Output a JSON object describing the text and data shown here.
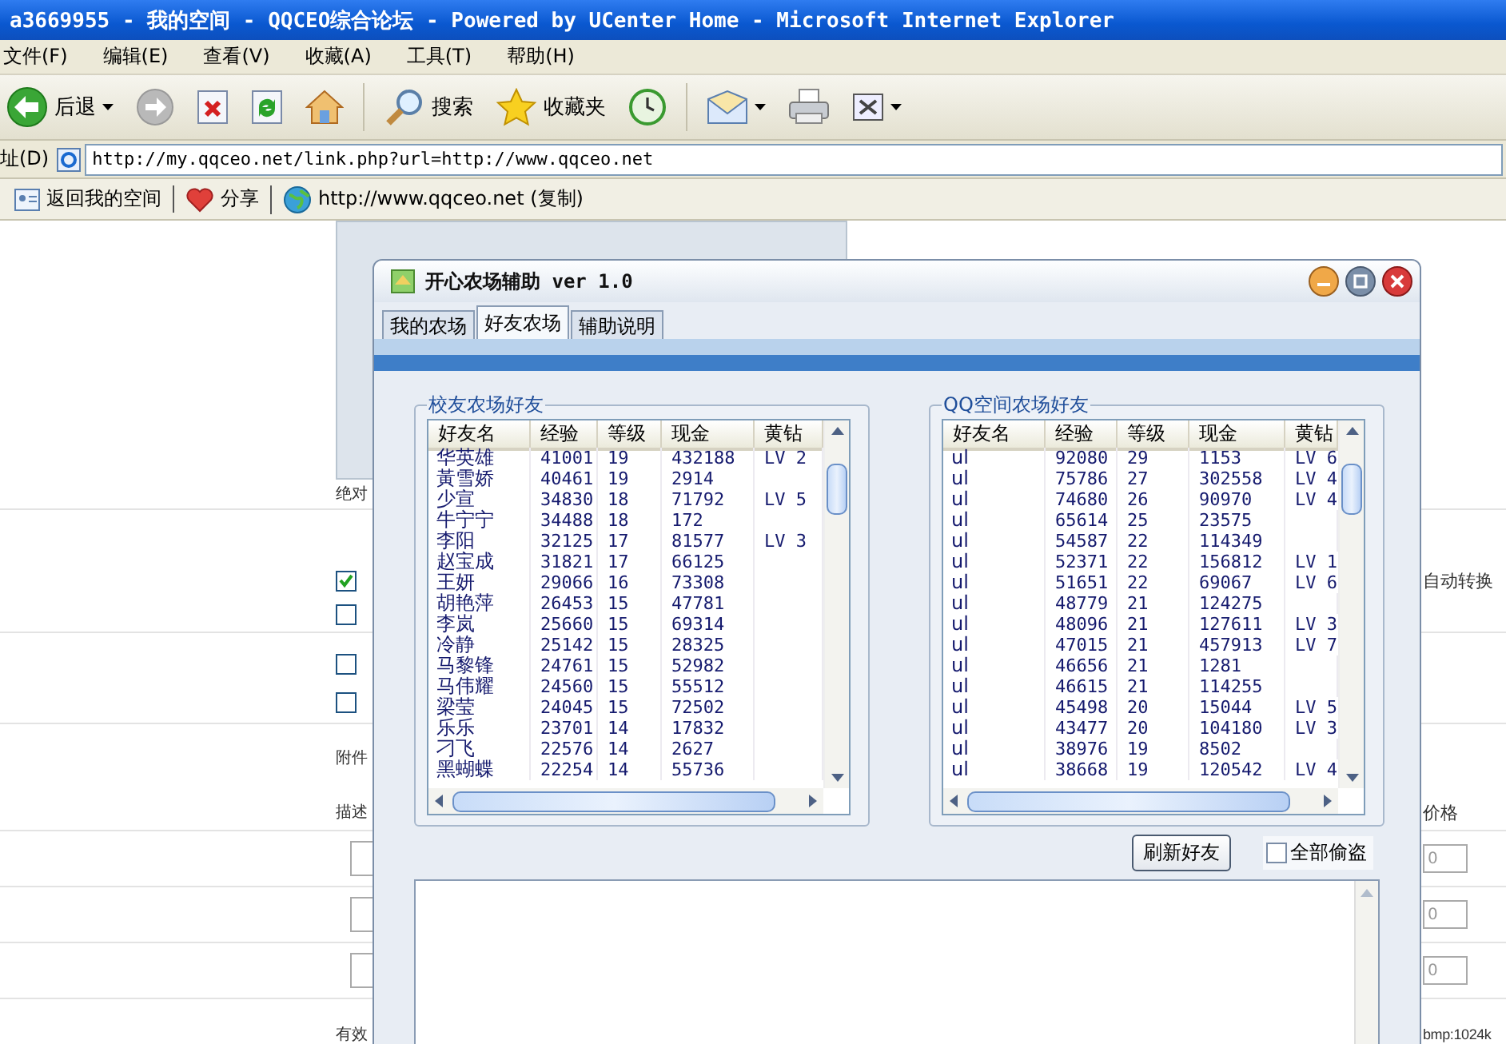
{
  "browser": {
    "title": "a3669955 - 我的空间 - QQCEO综合论坛 - Powered by UCenter Home - Microsoft Internet Explorer",
    "menu": [
      "文件(F)",
      "编辑(E)",
      "查看(V)",
      "收藏(A)",
      "工具(T)",
      "帮助(H)"
    ],
    "toolbar": [
      {
        "kind": "back",
        "label": "后退"
      },
      {
        "kind": "forward"
      },
      {
        "kind": "stop"
      },
      {
        "kind": "refresh"
      },
      {
        "kind": "home"
      },
      {
        "kind": "search",
        "label": "搜索"
      },
      {
        "kind": "favorites",
        "label": "收藏夹"
      },
      {
        "kind": "history"
      },
      {
        "kind": "mail"
      },
      {
        "kind": "print"
      },
      {
        "kind": "edit"
      }
    ],
    "address_label": "址(D)",
    "address": "http://my.qqceo.net/link.php?url=http://www.qqceo.net",
    "links": [
      {
        "kind": "card",
        "label": "返回我的空间"
      },
      {
        "kind": "heart",
        "label": "分享"
      },
      {
        "kind": "globe",
        "label": "http://www.qqceo.net (复制)"
      }
    ]
  },
  "page": {
    "caption": "绝对",
    "options": [
      {
        "checked": true
      },
      {
        "checked": false
      },
      {
        "checked": false
      },
      {
        "checked": false
      }
    ],
    "right_option": "自动转换",
    "attach_label": "附件",
    "desc_header": "描述",
    "price_header": "价格",
    "price_inputs": [
      "0",
      "0",
      "0"
    ],
    "footer_left": "有效",
    "footer_right": "bmp:1024k"
  },
  "dialog": {
    "title": "开心农场辅助 ver 1.0",
    "tabs": [
      {
        "label": "我的农场",
        "selected": false
      },
      {
        "label": "好友农场",
        "selected": true
      },
      {
        "label": "辅助说明",
        "selected": false
      }
    ],
    "groups": [
      {
        "title": "校友农场好友",
        "columns": [
          "好友名",
          "经验",
          "等级",
          "现金",
          "黄钻"
        ],
        "rows": [
          {
            "name": "华英雄",
            "exp": "41001",
            "rank": "19",
            "gold": "432188",
            "vip": "LV 2"
          },
          {
            "name": "黃雪娇",
            "exp": "40461",
            "rank": "19",
            "gold": "2914"
          },
          {
            "name": "少宣",
            "exp": "34830",
            "rank": "18",
            "gold": "71792",
            "vip": "LV 5"
          },
          {
            "name": "牛宁宁",
            "exp": "34488",
            "rank": "18",
            "gold": "172"
          },
          {
            "name": "李阳",
            "exp": "32125",
            "rank": "17",
            "gold": "81577",
            "vip": "LV 3"
          },
          {
            "name": "赵宝成",
            "exp": "31821",
            "rank": "17",
            "gold": "66125"
          },
          {
            "name": "王妍",
            "exp": "29066",
            "rank": "16",
            "gold": "73308"
          },
          {
            "name": "胡艳萍",
            "exp": "26453",
            "rank": "15",
            "gold": "47781"
          },
          {
            "name": "李岚",
            "exp": "25660",
            "rank": "15",
            "gold": "69314"
          },
          {
            "name": "冷静",
            "exp": "25142",
            "rank": "15",
            "gold": "28325"
          },
          {
            "name": "马黎锋",
            "exp": "24761",
            "rank": "15",
            "gold": "52982"
          },
          {
            "name": "马伟耀",
            "exp": "24560",
            "rank": "15",
            "gold": "55512"
          },
          {
            "name": "梁莹",
            "exp": "24045",
            "rank": "15",
            "gold": "72502"
          },
          {
            "name": "乐乐",
            "exp": "23701",
            "rank": "14",
            "gold": "17832"
          },
          {
            "name": "刁飞",
            "exp": "22576",
            "rank": "14",
            "gold": "2627"
          },
          {
            "name": "黑蝴蝶",
            "exp": "22254",
            "rank": "14",
            "gold": "55736"
          }
        ]
      },
      {
        "title": "QQ空间农场好友",
        "columns": [
          "好友名",
          "经验",
          "等级",
          "现金",
          "黄钻"
        ],
        "rows": [
          {
            "name": "ul",
            "exp": "92080",
            "rank": "29",
            "gold": "1153",
            "vip": "LV 6"
          },
          {
            "name": "ul",
            "exp": "75786",
            "rank": "27",
            "gold": "302558",
            "vip": "LV 4"
          },
          {
            "name": "ul",
            "exp": "74680",
            "rank": "26",
            "gold": "90970",
            "vip": "LV 4"
          },
          {
            "name": "ul",
            "exp": "65614",
            "rank": "25",
            "gold": "23575"
          },
          {
            "name": "ul",
            "exp": "54587",
            "rank": "22",
            "gold": "114349"
          },
          {
            "name": "ul",
            "exp": "52371",
            "rank": "22",
            "gold": "156812",
            "vip": "LV 1"
          },
          {
            "name": "ul",
            "exp": "51651",
            "rank": "22",
            "gold": "69067",
            "vip": "LV 6"
          },
          {
            "name": "ul",
            "exp": "48779",
            "rank": "21",
            "gold": "124275"
          },
          {
            "name": "ul",
            "exp": "48096",
            "rank": "21",
            "gold": "127611",
            "vip": "LV 3"
          },
          {
            "name": "ul",
            "exp": "47015",
            "rank": "21",
            "gold": "457913",
            "vip": "LV 7"
          },
          {
            "name": "ul",
            "exp": "46656",
            "rank": "21",
            "gold": "1281"
          },
          {
            "name": "ul",
            "exp": "46615",
            "rank": "21",
            "gold": "114255"
          },
          {
            "name": "ul",
            "exp": "45498",
            "rank": "20",
            "gold": "15044",
            "vip": "LV 5"
          },
          {
            "name": "ul",
            "exp": "43477",
            "rank": "20",
            "gold": "104180",
            "vip": "LV 3"
          },
          {
            "name": "ul",
            "exp": "38976",
            "rank": "19",
            "gold": "8502"
          },
          {
            "name": "ul",
            "exp": "38668",
            "rank": "19",
            "gold": "120542",
            "vip": "LV 4"
          }
        ]
      }
    ],
    "refresh_button": "刷新好友",
    "steal_all": {
      "label": "全部偷盗",
      "checked": false
    }
  }
}
